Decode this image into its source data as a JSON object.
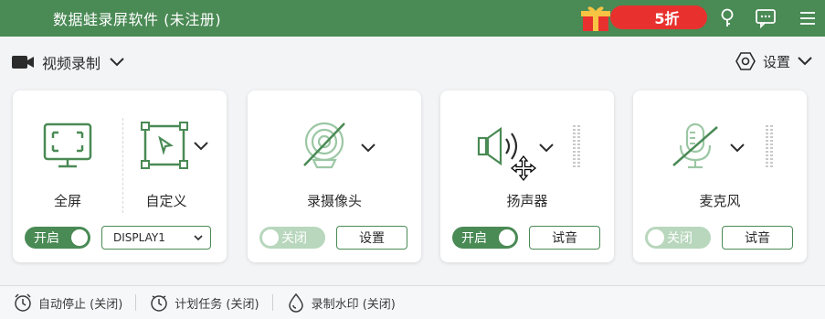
{
  "app": {
    "title": "数据蛙录屏软件 (未注册)",
    "promo_text": "5折"
  },
  "mode": {
    "label": "视频录制"
  },
  "settings": {
    "label": "设置"
  },
  "screen_card": {
    "full_label": "全屏",
    "custom_label": "自定义",
    "toggle_label": "开启",
    "display_value": "DISPLAY1"
  },
  "camera_card": {
    "label": "录摄像头",
    "toggle_label": "关闭",
    "button_label": "设置"
  },
  "speaker_card": {
    "label": "扬声器",
    "toggle_label": "开启",
    "button_label": "试音"
  },
  "mic_card": {
    "label": "麦克风",
    "toggle_label": "关闭",
    "button_label": "试音"
  },
  "footer": {
    "auto_stop": "自动停止 (关闭)",
    "schedule": "计划任务 (关闭)",
    "watermark": "录制水印 (关闭)"
  },
  "colors": {
    "accent": "#4a8a55",
    "accent_light": "#b8d7bd",
    "promo": "#e8312e"
  }
}
